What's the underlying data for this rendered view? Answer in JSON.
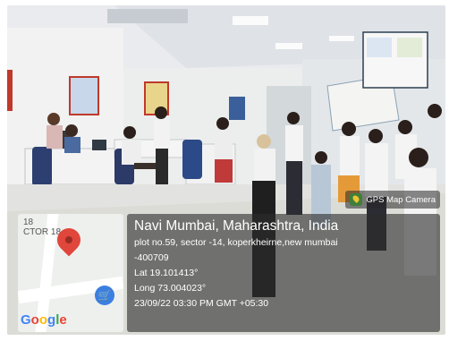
{
  "overlay": {
    "camera_app": "GPS Map Camera",
    "title": "Navi Mumbai, Maharashtra, India",
    "address_line1": "plot no.59, sector -14, koperkheirne,new mumbai",
    "address_line2": "-400709",
    "lat": "Lat 19.101413°",
    "long": "Long 73.004023°",
    "datetime": "23/09/22 03:30 PM GMT +05:30"
  },
  "map": {
    "label_top": "18",
    "label_street": "CTOR 18",
    "brand": "Google",
    "brand_colors": [
      "#4285F4",
      "#EA4335",
      "#FBBC05",
      "#4285F4",
      "#34A853",
      "#EA4335"
    ]
  }
}
